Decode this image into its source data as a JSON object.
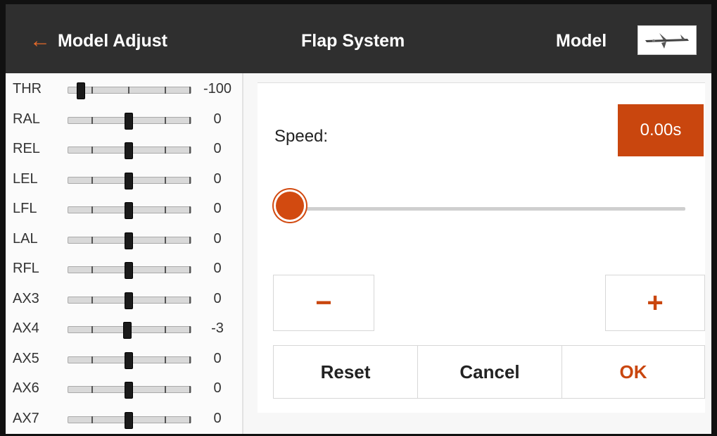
{
  "header": {
    "back_label": "Model Adjust",
    "title": "Flap System",
    "model_label": "Model",
    "back_icon": "arrow-left-icon"
  },
  "channels": [
    {
      "name": "THR",
      "value": "-100",
      "pos": -100
    },
    {
      "name": "RAL",
      "value": "0",
      "pos": 0
    },
    {
      "name": "REL",
      "value": "0",
      "pos": 0
    },
    {
      "name": "LEL",
      "value": "0",
      "pos": 0
    },
    {
      "name": "LFL",
      "value": "0",
      "pos": 0
    },
    {
      "name": "LAL",
      "value": "0",
      "pos": 0
    },
    {
      "name": "RFL",
      "value": "0",
      "pos": 0
    },
    {
      "name": "AX3",
      "value": "0",
      "pos": 0
    },
    {
      "name": "AX4",
      "value": "-3",
      "pos": -3
    },
    {
      "name": "AX5",
      "value": "0",
      "pos": 0
    },
    {
      "name": "AX6",
      "value": "0",
      "pos": 0
    },
    {
      "name": "AX7",
      "value": "0",
      "pos": 0
    }
  ],
  "speed": {
    "label": "Speed:",
    "value": "0.00s",
    "slider_fraction": 0
  },
  "buttons": {
    "minus": "−",
    "plus": "+",
    "reset": "Reset",
    "cancel": "Cancel",
    "ok": "OK"
  },
  "colors": {
    "accent": "#c9460e",
    "header_bg": "#2f2f2f"
  }
}
